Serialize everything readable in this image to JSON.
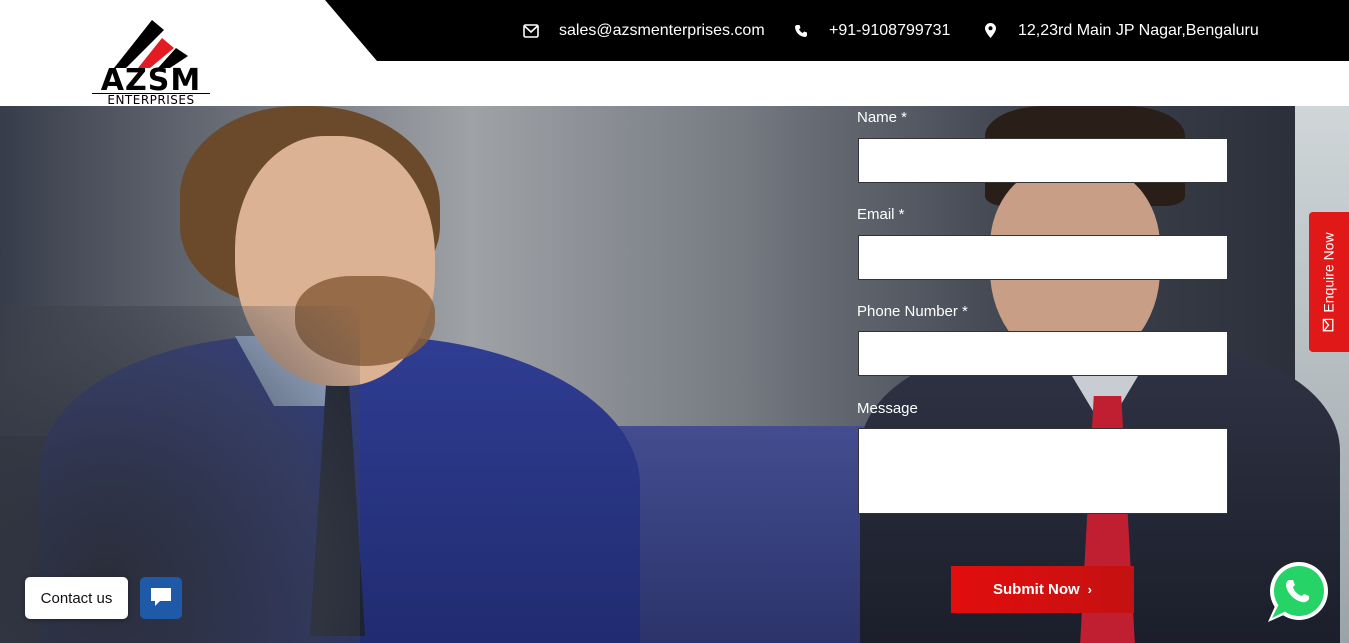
{
  "header": {
    "logo": {
      "name": "AZSM",
      "subtitle": "ENTERPRISES"
    },
    "contact": {
      "email": "sales@azsmenterprises.com",
      "phone": "+91-9108799731",
      "address": "12,23rd Main JP Nagar,Bengaluru"
    }
  },
  "form": {
    "name_label": "Name *",
    "email_label": "Email *",
    "phone_label": "Phone Number *",
    "message_label": "Message",
    "name_value": "",
    "email_value": "",
    "phone_value": "",
    "message_value": "",
    "submit_label": "Submit Now"
  },
  "side_tab": {
    "label": "Enquire Now"
  },
  "widgets": {
    "contact_label": "Contact us"
  },
  "colors": {
    "accent_red": "#e30d0d",
    "topbar": "#000000",
    "chat_blue": "#1e5aa8",
    "whatsapp_green": "#25d366"
  },
  "icons": [
    "envelope-icon",
    "phone-icon",
    "map-marker-icon",
    "chat-icon",
    "whatsapp-icon",
    "chevron-right-icon"
  ]
}
